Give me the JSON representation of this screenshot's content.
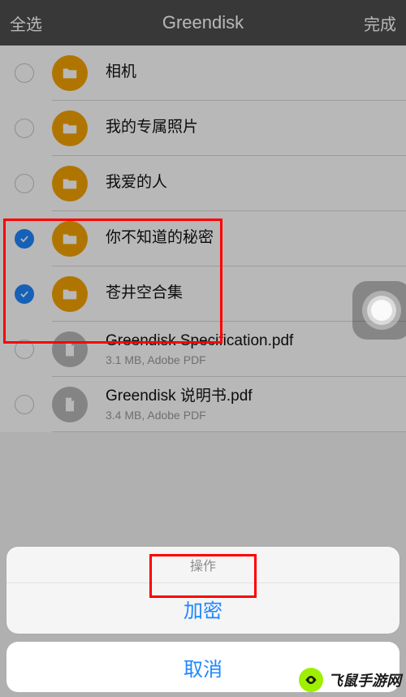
{
  "header": {
    "left": "全选",
    "title": "Greendisk",
    "right": "完成"
  },
  "rows": [
    {
      "type": "folder",
      "selected": false,
      "title": "相机",
      "sub": ""
    },
    {
      "type": "folder",
      "selected": false,
      "title": "我的专属照片",
      "sub": ""
    },
    {
      "type": "folder",
      "selected": false,
      "title": "我爱的人",
      "sub": ""
    },
    {
      "type": "folder",
      "selected": true,
      "title": "你不知道的秘密",
      "sub": ""
    },
    {
      "type": "folder",
      "selected": true,
      "title": "苍井空合集",
      "sub": ""
    },
    {
      "type": "file",
      "selected": false,
      "title": "Greendisk Specification.pdf",
      "sub": "3.1 MB, Adobe PDF"
    },
    {
      "type": "file",
      "selected": false,
      "title": "Greendisk 说明书.pdf",
      "sub": "3.4 MB, Adobe PDF"
    }
  ],
  "sheet": {
    "label": "操作",
    "action": "加密",
    "cancel": "取消"
  },
  "watermark": "飞鼠手游网"
}
